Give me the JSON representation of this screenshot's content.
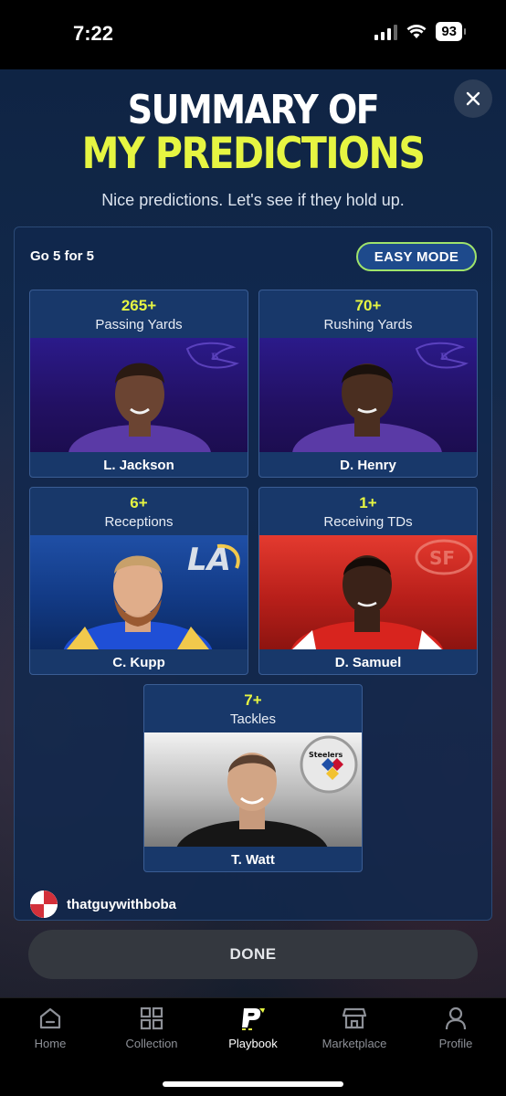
{
  "status": {
    "time": "7:22",
    "battery": "93"
  },
  "header": {
    "title_line1": "SUMMARY OF",
    "title_line2": "MY PREDICTIONS",
    "subtitle": "Nice predictions. Let's see if they hold up."
  },
  "panel": {
    "label": "Go 5 for 5",
    "mode_button": "EASY MODE",
    "accent_color": "#e6f542",
    "cards": [
      {
        "value": "265+",
        "stat": "Passing Yards",
        "player": "L. Jackson",
        "team_logo": "ravens-logo"
      },
      {
        "value": "70+",
        "stat": "Rushing Yards",
        "player": "D. Henry",
        "team_logo": "ravens-logo"
      },
      {
        "value": "6+",
        "stat": "Receptions",
        "player": "C. Kupp",
        "team_logo": "rams-logo"
      },
      {
        "value": "1+",
        "stat": "Receiving TDs",
        "player": "D. Samuel",
        "team_logo": "49ers-logo"
      },
      {
        "value": "7+",
        "stat": "Tackles",
        "player": "T. Watt",
        "team_logo": "steelers-logo",
        "logo_text": "Steelers"
      }
    ],
    "username": "thatguywithboba"
  },
  "done_button": "DONE",
  "tabs": [
    {
      "label": "Home",
      "icon": "home-icon"
    },
    {
      "label": "Collection",
      "icon": "grid-icon"
    },
    {
      "label": "Playbook",
      "icon": "playbook-icon",
      "active": true
    },
    {
      "label": "Marketplace",
      "icon": "store-icon"
    },
    {
      "label": "Profile",
      "icon": "profile-icon"
    }
  ]
}
